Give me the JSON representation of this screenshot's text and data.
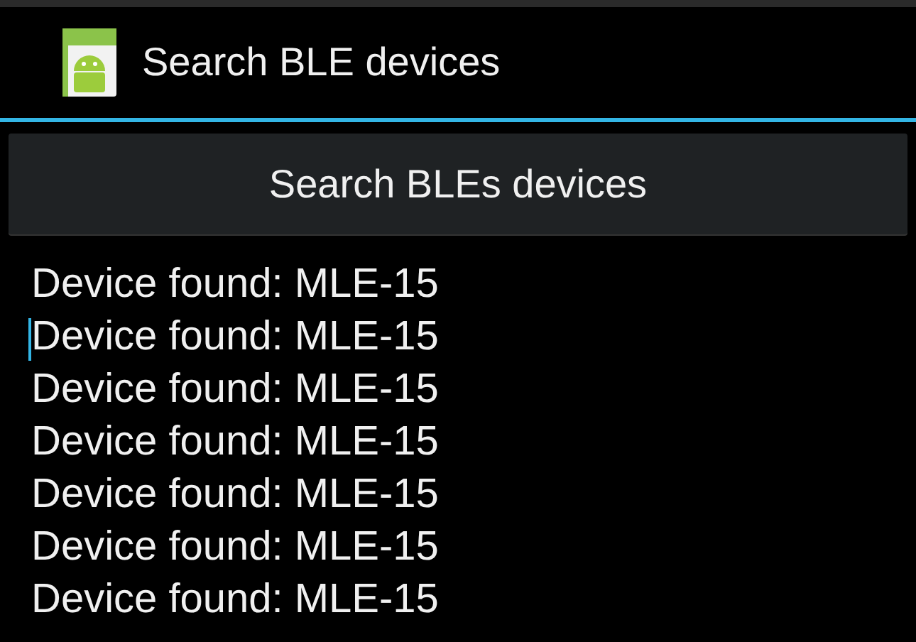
{
  "action_bar": {
    "title": "Search BLE devices"
  },
  "button": {
    "label": "Search BLEs devices"
  },
  "results": [
    {
      "text": "Device found: MLE-15",
      "caret": false
    },
    {
      "text": "Device found: MLE-15",
      "caret": true
    },
    {
      "text": "Device found: MLE-15",
      "caret": false
    },
    {
      "text": "Device found: MLE-15",
      "caret": false
    },
    {
      "text": "Device found: MLE-15",
      "caret": false
    },
    {
      "text": "Device found: MLE-15",
      "caret": false
    },
    {
      "text": "Device found: MLE-15",
      "caret": false
    }
  ]
}
